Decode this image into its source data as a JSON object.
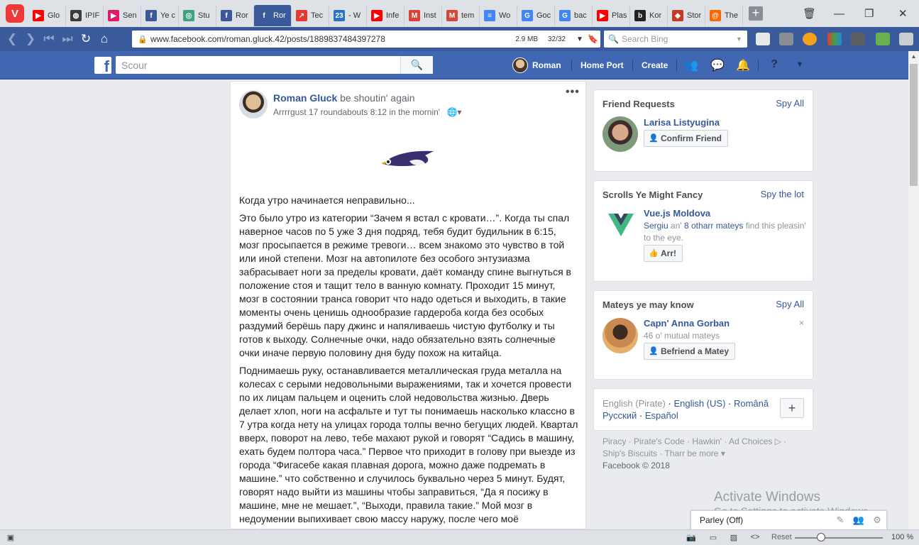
{
  "browser": {
    "tabs": [
      {
        "label": "Glo",
        "icon": "youtube-icon",
        "color": "#ff0000",
        "glyph": "▶"
      },
      {
        "label": "IPIF",
        "icon": "globe-icon",
        "color": "#3c3c3c",
        "glyph": "◍"
      },
      {
        "label": "Sen",
        "icon": "sendpulse-icon",
        "color": "#e01b6a",
        "glyph": "▶"
      },
      {
        "label": "Ye c",
        "icon": "facebook-icon",
        "color": "#3b5998",
        "glyph": "f"
      },
      {
        "label": "Stu",
        "icon": "stumble-icon",
        "color": "#3aa57c",
        "glyph": "◎"
      },
      {
        "label": "Ror",
        "icon": "facebook-icon",
        "color": "#3b5998",
        "glyph": "f"
      },
      {
        "label": "Ror",
        "icon": "facebook-icon",
        "color": "#3b5998",
        "glyph": "f"
      },
      {
        "label": "Tec",
        "icon": "arrow-icon",
        "color": "#e6392f",
        "glyph": "↗"
      },
      {
        "label": "- W",
        "icon": "calendar-icon",
        "color": "#2d73c4",
        "glyph": "23"
      },
      {
        "label": "Infe",
        "icon": "youtube-icon",
        "color": "#ff0000",
        "glyph": "▶"
      },
      {
        "label": "Inst",
        "icon": "gmail-icon",
        "color": "#d44638",
        "glyph": "M"
      },
      {
        "label": "tem",
        "icon": "gmail-icon",
        "color": "#d44638",
        "glyph": "M"
      },
      {
        "label": "Wo",
        "icon": "docs-icon",
        "color": "#4285f4",
        "glyph": "≡"
      },
      {
        "label": "Goc",
        "icon": "translate-icon",
        "color": "#4285f4",
        "glyph": "G"
      },
      {
        "label": "bac",
        "icon": "google-icon",
        "color": "#4285f4",
        "glyph": "G"
      },
      {
        "label": "Plas",
        "icon": "youtube-icon",
        "color": "#ff0000",
        "glyph": "▶"
      },
      {
        "label": "Kor",
        "icon": "bookmark-b-icon",
        "color": "#222222",
        "glyph": "b"
      },
      {
        "label": "Stor",
        "icon": "shield-icon",
        "color": "#c23b22",
        "glyph": "◆"
      },
      {
        "label": "The",
        "icon": "at-icon",
        "color": "#ff6600",
        "glyph": "@"
      }
    ],
    "active_tab_index": 6,
    "url": "www.facebook.com/roman.gluck.42/posts/1889837484397278",
    "page_size": "2.9 MB",
    "resource_count": "32/32",
    "search_placeholder": "Search Bing"
  },
  "fb": {
    "logo": "f",
    "search_placeholder": "Scour",
    "nav": {
      "profile_name": "Roman",
      "home": "Home Port",
      "create": "Create"
    }
  },
  "post": {
    "author": "Roman Gluck",
    "action": " be shoutin' again",
    "meta": "Arrrrgust 17 roundabouts 8:12 in the mornin'",
    "more": "•••",
    "paragraphs": [
      "Когда утро начинается неправильно...",
      "Это было утро из категории “Зачем я встал с кровати…”. Когда ты спал наверное часов по 5 уже 3 дня подряд, тебя будит будильник в 6:15, мозг просыпается в режиме тревоги… всем знакомо это чувство в той или иной степени. Мозг на автопилоте без особого энтузиазма забрасывает ноги за пределы кровати, даёт команду спине выгнуться в положение стоя и тащит тело в ванную комнату. Проходит 15 минут, мозг в состоянии транса говорит что надо одеться и выходить, в такие моменты очень ценишь однообразие гардероба когда без особых раздумий берёшь пару джинс и напяливаешь чистую футболку и ты готов к выходу. Солнечные очки, надо обязательно взять солнечные очки иначе первую половину дня буду похож на китайца.",
      "Поднимаешь руку, останавливается металлическая груда металла на колесах с серыми недовольными выражениями, так и хочется провести по их лицам пальцем и оценить слой недовольства жизнью. Дверь делает хлоп, ноги на асфальте и тут ты понимаешь насколько классно в 7 утра когда нету на улицах города толпы вечно бегущих людей. Квартал вверх, поворот на лево, тебе махают рукой и говорят “Садись в машину, ехать будем полтора часа.” Первое что приходит в голову при выезде из города “Фигасебе какая плавная дорога, можно даже подремать в машине.” что собственно и случилось буквально через 5 минут. Будят, говорят надо выйти из машины чтобы заправиться, “Да я посижу в машине, мне не мешает.”, “Выходи, правила такие.” Мой мозг в недоумении выпихивает свою массу наружу, после чего моё любопытство видит невероятно живописную картину которая открывает глазам"
    ]
  },
  "friend_requests": {
    "title": "Friend Requests",
    "link": "Spy All",
    "name": "Larisa Listyugina",
    "button": "Confirm Friend"
  },
  "pages": {
    "title": "Scrolls Ye Might Fancy",
    "link": "Spy the lot",
    "name": "Vue.js Moldova",
    "friend": "Sergiu",
    "and": " an' ",
    "others": "8 otharr mateys",
    "rest": " find this pleasin' to the eye.",
    "button": "Arr!"
  },
  "pymk": {
    "title": "Mateys ye may know",
    "link": "Spy All",
    "name": "Capn' Anna Gorban",
    "mutual": "46 o' mutual mateys",
    "button": "Befriend a Matey",
    "close": "×"
  },
  "languages": {
    "current": "English (Pirate)",
    "others": [
      "English (US)",
      "Română",
      "Русский",
      "Español"
    ],
    "add": "+"
  },
  "footer": {
    "row1": [
      "Piracy",
      "Pirate's Code",
      "Hawkin'",
      "Ad Choices ▷"
    ],
    "row2": [
      "Ship's Biscuits",
      "Tharr be more ▾"
    ],
    "copyright": "Facebook © 2018"
  },
  "watermark": {
    "line1": "Activate Windows",
    "line2": "Go to Settings to activate Windows."
  },
  "chat": {
    "label": "Parley (Off)"
  },
  "status": {
    "reset": "Reset",
    "zoom": "100 %",
    "zoom_fraction": 0.3
  }
}
